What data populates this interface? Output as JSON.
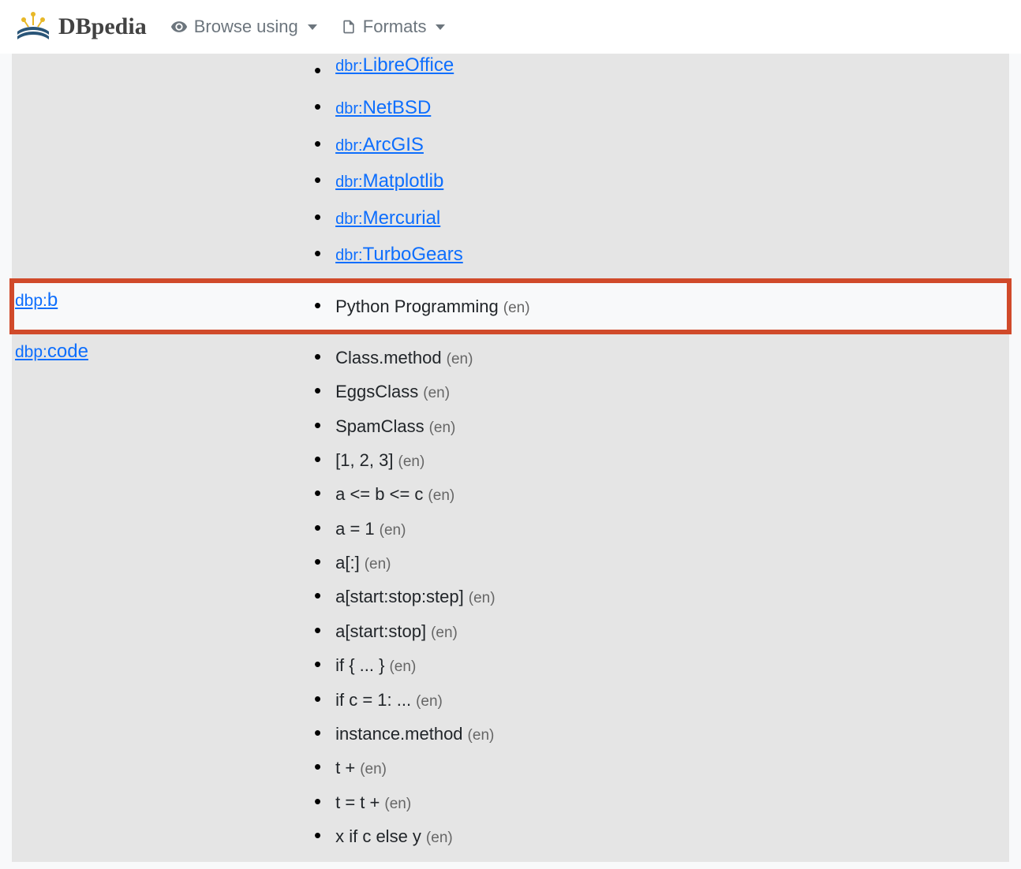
{
  "header": {
    "brand": "DBpedia",
    "browse_label": "Browse using",
    "formats_label": "Formats"
  },
  "row0": {
    "items": [
      {
        "prefix": "dbr:",
        "local": "LibreOffice"
      },
      {
        "prefix": "dbr:",
        "local": "NetBSD"
      },
      {
        "prefix": "dbr:",
        "local": "ArcGIS"
      },
      {
        "prefix": "dbr:",
        "local": "Matplotlib"
      },
      {
        "prefix": "dbr:",
        "local": "Mercurial"
      },
      {
        "prefix": "dbr:",
        "local": "TurboGears"
      }
    ]
  },
  "row1": {
    "prop_prefix": "dbp:",
    "prop_local": "b",
    "items": [
      {
        "text": "Python Programming",
        "lang": "(en)"
      }
    ]
  },
  "row2": {
    "prop_prefix": "dbp:",
    "prop_local": "code",
    "items": [
      {
        "text": "Class.method",
        "lang": "(en)"
      },
      {
        "text": "EggsClass",
        "lang": "(en)"
      },
      {
        "text": "SpamClass",
        "lang": "(en)"
      },
      {
        "text": "[1, 2, 3]",
        "lang": "(en)"
      },
      {
        "text": "a <= b <= c",
        "lang": "(en)"
      },
      {
        "text": "a = 1",
        "lang": "(en)"
      },
      {
        "text": "a[:]",
        "lang": "(en)"
      },
      {
        "text": "a[start:stop:step]",
        "lang": "(en)"
      },
      {
        "text": "a[start:stop]",
        "lang": "(en)"
      },
      {
        "text": "if { ... }",
        "lang": "(en)"
      },
      {
        "text": "if c = 1: ...",
        "lang": "(en)"
      },
      {
        "text": "instance.method",
        "lang": "(en)"
      },
      {
        "text": "t +",
        "lang": "(en)"
      },
      {
        "text": "t = t +",
        "lang": "(en)"
      },
      {
        "text": "x if c else y",
        "lang": "(en)"
      }
    ]
  }
}
